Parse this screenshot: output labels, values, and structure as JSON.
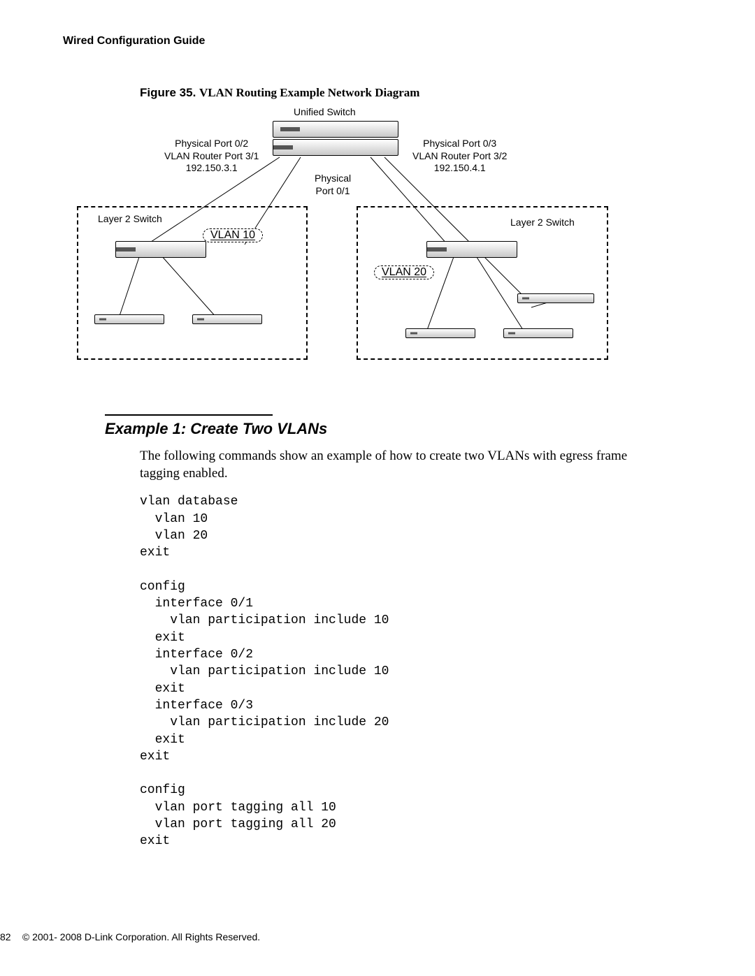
{
  "running_head": "Wired Configuration Guide",
  "figure": {
    "prefix": "Figure 35. ",
    "title": "VLAN Routing Example Network Diagram"
  },
  "diagram": {
    "unified_switch": "Unified Switch",
    "port02": "Physical Port 0/2\nVLAN Router Port 3/1\n192.150.3.1",
    "port03": "Physical Port 0/3\nVLAN Router Port 3/2\n192.150.4.1",
    "port01": "Physical\nPort 0/1",
    "l2_left": "Layer 2 Switch",
    "l2_right": "Layer 2 Switch",
    "vlan10": "VLAN 10",
    "vlan20": "VLAN 20"
  },
  "section_heading": "Example 1: Create Two VLANs",
  "section_para": "The following commands show an example of how to create two VLANs with egress frame tagging enabled.",
  "code": "vlan database\n  vlan 10\n  vlan 20\nexit\n\nconfig\n  interface 0/1\n    vlan participation include 10\n  exit\n  interface 0/2\n    vlan participation include 10\n  exit\n  interface 0/3\n    vlan participation include 20\n  exit\nexit\n\nconfig\n  vlan port tagging all 10\n  vlan port tagging all 20\nexit",
  "footer": {
    "page": "82",
    "copyright": "© 2001- 2008 D-Link Corporation. All Rights Reserved."
  }
}
